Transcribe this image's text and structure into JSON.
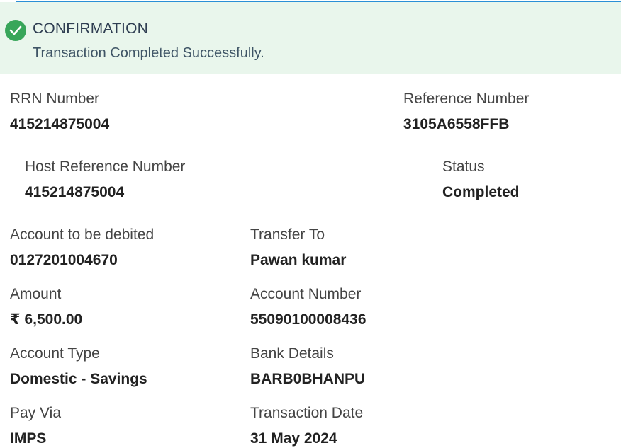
{
  "banner": {
    "title": "CONFIRMATION",
    "message": "Transaction Completed Successfully."
  },
  "fields": {
    "rrn": {
      "label": "RRN Number",
      "value": "415214875004"
    },
    "reference": {
      "label": "Reference Number",
      "value": "3105A6558FFB"
    },
    "host_reference": {
      "label": "Host Reference Number",
      "value": "415214875004"
    },
    "status": {
      "label": "Status",
      "value": "Completed"
    },
    "account_debited": {
      "label": "Account to be debited",
      "value": "0127201004670"
    },
    "transfer_to": {
      "label": "Transfer To",
      "value": "Pawan kumar"
    },
    "amount": {
      "label": "Amount",
      "value": "₹ 6,500.00"
    },
    "account_number": {
      "label": "Account Number",
      "value": "55090100008436"
    },
    "account_type": {
      "label": "Account Type",
      "value": "Domestic - Savings"
    },
    "bank_details": {
      "label": "Bank Details",
      "value": "BARB0BHANPU"
    },
    "pay_via": {
      "label": "Pay Via",
      "value": "IMPS"
    },
    "transaction_date": {
      "label": "Transaction Date",
      "value": "31 May 2024"
    }
  },
  "colors": {
    "success": "#38a65a",
    "banner_bg": "#e9f6ec",
    "accent_line": "#2b8fd6"
  },
  "icons": {
    "banner_icon": "check-circle-icon"
  }
}
